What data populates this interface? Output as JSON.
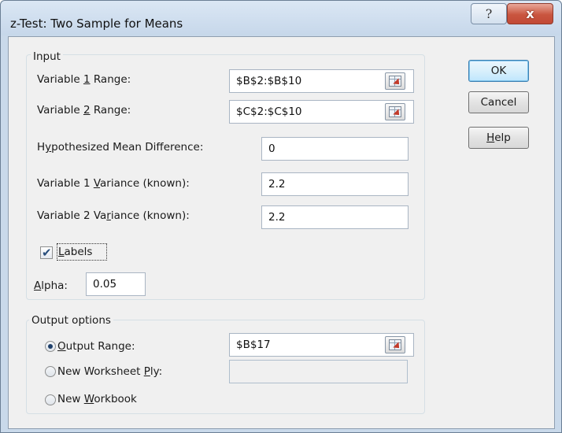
{
  "dialog": {
    "title": "z-Test: Two Sample for Means",
    "help_glyph": "?",
    "close_glyph": "x"
  },
  "input_group": {
    "label": "Input",
    "variable1_range": {
      "label_pre": "Variable ",
      "label_key": "1",
      "label_post": " Range:",
      "value": "$B$2:$B$10"
    },
    "variable2_range": {
      "label_pre": "Variable ",
      "label_key": "2",
      "label_post": " Range:",
      "value": "$C$2:$C$10"
    },
    "hypothesized_mean_difference": {
      "label_pre": "H",
      "label_key": "y",
      "label_post": "pothesized Mean Difference:",
      "value": "0"
    },
    "variable1_variance": {
      "label_pre": "Variable 1 ",
      "label_key": "V",
      "label_post": "ariance (known):",
      "value": "2.2"
    },
    "variable2_variance": {
      "label_pre": "Variable 2 Va",
      "label_key": "r",
      "label_post": "iance (known):",
      "value": "2.2"
    },
    "labels": {
      "label_pre": "",
      "label_key": "L",
      "label_post": "abels",
      "checked": true
    },
    "alpha": {
      "label_pre": "",
      "label_key": "A",
      "label_post": "lpha:",
      "value": "0.05"
    }
  },
  "output_group": {
    "label": "Output options",
    "output_range": {
      "label_pre": "",
      "label_key": "O",
      "label_post": "utput Range:",
      "value": "$B$17",
      "selected": true
    },
    "new_worksheet_ply": {
      "label_pre": "New Worksheet ",
      "label_key": "P",
      "label_post": "ly:",
      "value": "",
      "selected": false
    },
    "new_workbook": {
      "label_pre": "New ",
      "label_key": "W",
      "label_post": "orkbook",
      "selected": false
    }
  },
  "buttons": {
    "ok": "OK",
    "cancel": "Cancel",
    "help_pre": "",
    "help_key": "H",
    "help_post": "elp"
  },
  "icons": {
    "help": "question-icon",
    "close": "close-icon",
    "range_selector": "collapse-dialog-icon",
    "checkbox": "checkmark-icon"
  },
  "colors": {
    "frame": "#c9d9ea",
    "close_button": "#c9553f",
    "dialog_background": "#f0f0f0"
  }
}
